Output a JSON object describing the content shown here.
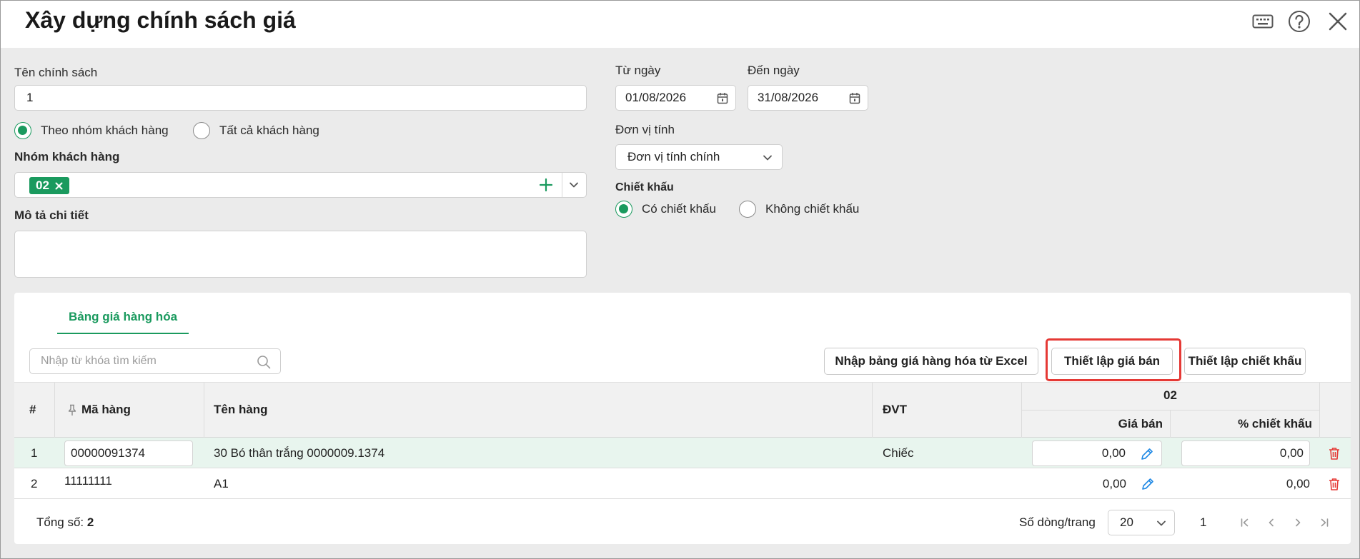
{
  "dialog": {
    "title": "Xây dựng chính sách giá"
  },
  "form": {
    "policy_name_label": "Tên chính sách",
    "policy_name_value": "1",
    "customer_scope": {
      "option_group": "Theo nhóm khách hàng",
      "option_all": "Tất cả khách hàng",
      "selected": "option_group"
    },
    "customer_group_label": "Nhóm khách hàng",
    "customer_group_chip": "02",
    "description_label": "Mô tả chi tiết",
    "description_value": "",
    "from_date_label": "Từ ngày",
    "from_date_value": "01/08/2026",
    "to_date_label": "Đến ngày",
    "to_date_value": "31/08/2026",
    "unit_label": "Đơn vị tính",
    "unit_value": "Đơn vị tính chính",
    "discount_label": "Chiết khấu",
    "discount_yes": "Có chiết khấu",
    "discount_no": "Không chiết khấu",
    "discount_selected": "yes"
  },
  "price_table": {
    "tab_label": "Bảng giá hàng hóa",
    "search_placeholder": "Nhập từ khóa tìm kiếm",
    "btn_import": "Nhập bảng giá hàng hóa từ Excel",
    "btn_set_price": "Thiết lập giá bán",
    "btn_set_discount": "Thiết lập chiết khấu",
    "columns": {
      "index": "#",
      "code": "Mã hàng",
      "name": "Tên hàng",
      "unit": "ĐVT",
      "group": "02",
      "price": "Giá bán",
      "discount_pct": "% chiết khấu"
    },
    "rows": [
      {
        "index": "1",
        "code": "00000091374",
        "name": "30 Bó thân trắng 0000009.1374",
        "unit": "Chiếc",
        "price": "0,00",
        "discount_pct": "0,00"
      },
      {
        "index": "2",
        "code": "11111111",
        "name": "A1",
        "unit": "",
        "price": "0,00",
        "discount_pct": "0,00"
      }
    ],
    "total_label": "Tổng số:",
    "total_value": "2",
    "rows_per_page_label": "Số dòng/trang",
    "rows_per_page_value": "20",
    "current_page": "1"
  },
  "colors": {
    "accent": "#1a9a5e",
    "highlight_box": "#e53935",
    "delete": "#e53935",
    "edit": "#1e88e5",
    "selected_row": "#e8f5ee"
  }
}
